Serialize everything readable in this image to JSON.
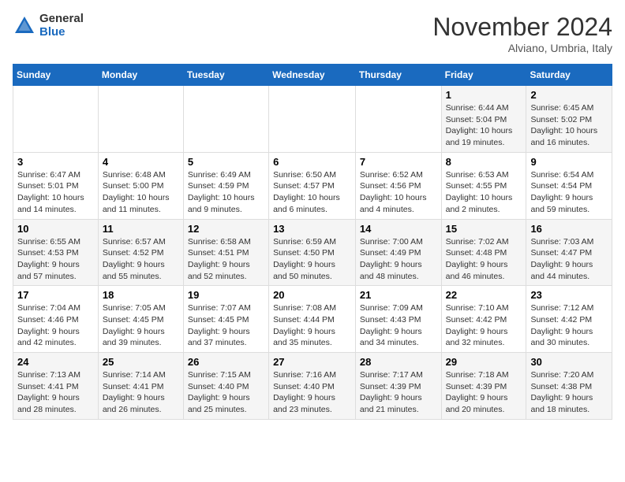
{
  "header": {
    "logo_general": "General",
    "logo_blue": "Blue",
    "month_title": "November 2024",
    "location": "Alviano, Umbria, Italy"
  },
  "weekdays": [
    "Sunday",
    "Monday",
    "Tuesday",
    "Wednesday",
    "Thursday",
    "Friday",
    "Saturday"
  ],
  "weeks": [
    [
      {
        "day": "",
        "info": ""
      },
      {
        "day": "",
        "info": ""
      },
      {
        "day": "",
        "info": ""
      },
      {
        "day": "",
        "info": ""
      },
      {
        "day": "",
        "info": ""
      },
      {
        "day": "1",
        "info": "Sunrise: 6:44 AM\nSunset: 5:04 PM\nDaylight: 10 hours\nand 19 minutes."
      },
      {
        "day": "2",
        "info": "Sunrise: 6:45 AM\nSunset: 5:02 PM\nDaylight: 10 hours\nand 16 minutes."
      }
    ],
    [
      {
        "day": "3",
        "info": "Sunrise: 6:47 AM\nSunset: 5:01 PM\nDaylight: 10 hours\nand 14 minutes."
      },
      {
        "day": "4",
        "info": "Sunrise: 6:48 AM\nSunset: 5:00 PM\nDaylight: 10 hours\nand 11 minutes."
      },
      {
        "day": "5",
        "info": "Sunrise: 6:49 AM\nSunset: 4:59 PM\nDaylight: 10 hours\nand 9 minutes."
      },
      {
        "day": "6",
        "info": "Sunrise: 6:50 AM\nSunset: 4:57 PM\nDaylight: 10 hours\nand 6 minutes."
      },
      {
        "day": "7",
        "info": "Sunrise: 6:52 AM\nSunset: 4:56 PM\nDaylight: 10 hours\nand 4 minutes."
      },
      {
        "day": "8",
        "info": "Sunrise: 6:53 AM\nSunset: 4:55 PM\nDaylight: 10 hours\nand 2 minutes."
      },
      {
        "day": "9",
        "info": "Sunrise: 6:54 AM\nSunset: 4:54 PM\nDaylight: 9 hours\nand 59 minutes."
      }
    ],
    [
      {
        "day": "10",
        "info": "Sunrise: 6:55 AM\nSunset: 4:53 PM\nDaylight: 9 hours\nand 57 minutes."
      },
      {
        "day": "11",
        "info": "Sunrise: 6:57 AM\nSunset: 4:52 PM\nDaylight: 9 hours\nand 55 minutes."
      },
      {
        "day": "12",
        "info": "Sunrise: 6:58 AM\nSunset: 4:51 PM\nDaylight: 9 hours\nand 52 minutes."
      },
      {
        "day": "13",
        "info": "Sunrise: 6:59 AM\nSunset: 4:50 PM\nDaylight: 9 hours\nand 50 minutes."
      },
      {
        "day": "14",
        "info": "Sunrise: 7:00 AM\nSunset: 4:49 PM\nDaylight: 9 hours\nand 48 minutes."
      },
      {
        "day": "15",
        "info": "Sunrise: 7:02 AM\nSunset: 4:48 PM\nDaylight: 9 hours\nand 46 minutes."
      },
      {
        "day": "16",
        "info": "Sunrise: 7:03 AM\nSunset: 4:47 PM\nDaylight: 9 hours\nand 44 minutes."
      }
    ],
    [
      {
        "day": "17",
        "info": "Sunrise: 7:04 AM\nSunset: 4:46 PM\nDaylight: 9 hours\nand 42 minutes."
      },
      {
        "day": "18",
        "info": "Sunrise: 7:05 AM\nSunset: 4:45 PM\nDaylight: 9 hours\nand 39 minutes."
      },
      {
        "day": "19",
        "info": "Sunrise: 7:07 AM\nSunset: 4:45 PM\nDaylight: 9 hours\nand 37 minutes."
      },
      {
        "day": "20",
        "info": "Sunrise: 7:08 AM\nSunset: 4:44 PM\nDaylight: 9 hours\nand 35 minutes."
      },
      {
        "day": "21",
        "info": "Sunrise: 7:09 AM\nSunset: 4:43 PM\nDaylight: 9 hours\nand 34 minutes."
      },
      {
        "day": "22",
        "info": "Sunrise: 7:10 AM\nSunset: 4:42 PM\nDaylight: 9 hours\nand 32 minutes."
      },
      {
        "day": "23",
        "info": "Sunrise: 7:12 AM\nSunset: 4:42 PM\nDaylight: 9 hours\nand 30 minutes."
      }
    ],
    [
      {
        "day": "24",
        "info": "Sunrise: 7:13 AM\nSunset: 4:41 PM\nDaylight: 9 hours\nand 28 minutes."
      },
      {
        "day": "25",
        "info": "Sunrise: 7:14 AM\nSunset: 4:41 PM\nDaylight: 9 hours\nand 26 minutes."
      },
      {
        "day": "26",
        "info": "Sunrise: 7:15 AM\nSunset: 4:40 PM\nDaylight: 9 hours\nand 25 minutes."
      },
      {
        "day": "27",
        "info": "Sunrise: 7:16 AM\nSunset: 4:40 PM\nDaylight: 9 hours\nand 23 minutes."
      },
      {
        "day": "28",
        "info": "Sunrise: 7:17 AM\nSunset: 4:39 PM\nDaylight: 9 hours\nand 21 minutes."
      },
      {
        "day": "29",
        "info": "Sunrise: 7:18 AM\nSunset: 4:39 PM\nDaylight: 9 hours\nand 20 minutes."
      },
      {
        "day": "30",
        "info": "Sunrise: 7:20 AM\nSunset: 4:38 PM\nDaylight: 9 hours\nand 18 minutes."
      }
    ]
  ]
}
